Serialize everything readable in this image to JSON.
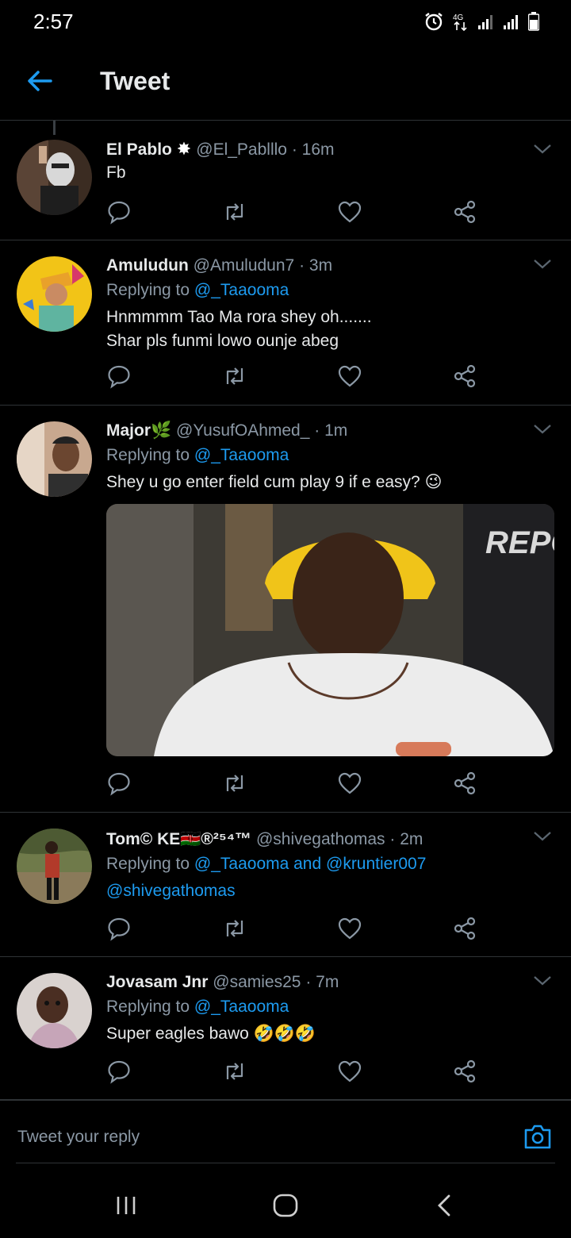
{
  "status_bar": {
    "time": "2:57",
    "network": "4G"
  },
  "header": {
    "title": "Tweet"
  },
  "tweets": [
    {
      "name": "El Pablo",
      "handle": "@El_Pablllo",
      "time": "· 16m",
      "replying_to": "",
      "text_lines": [
        "Fb"
      ]
    },
    {
      "name": "Amuludun",
      "handle": "@Amuludun7",
      "time": "· 3m",
      "replying_prefix": "Replying to",
      "replying_to": "@_Taaooma",
      "text_lines": [
        "Hnmmmm Tao Ma rora shey oh.......",
        "Shar pls funmi lowo ounje abeg"
      ]
    },
    {
      "name": "Major🌿",
      "handle": "@YusufOAhmed_",
      "time": "· 1m",
      "replying_prefix": "Replying to",
      "replying_to": "@_Taaooma",
      "text_lines": [
        "Shey u go enter field cum play 9 if e easy? 😉"
      ],
      "media_text": "REPO"
    },
    {
      "name": "Tom© KE🇰🇪®²⁵⁴™",
      "handle": "@shivegathomas",
      "time": "· 2m",
      "replying_prefix": "Replying to",
      "replying_to": "@_Taaooma and @kruntier007",
      "text_lines": [
        "@shivegathomas"
      ]
    },
    {
      "name": "Jovasam Jnr",
      "handle": "@samies25",
      "time": "· 7m",
      "replying_prefix": "Replying to",
      "replying_to": "@_Taaooma",
      "text_lines": [
        "Super eagles bawo 🤣🤣🤣"
      ]
    }
  ],
  "reply_bar": {
    "placeholder": "Tweet your reply"
  },
  "icons": {
    "back": "arrow-left-icon",
    "reply": "comment-icon",
    "retweet": "retweet-icon",
    "like": "heart-icon",
    "share": "share-icon",
    "camera": "camera-icon"
  },
  "colors": {
    "accent": "#1d9bf0",
    "background": "#000000",
    "secondary_text": "#8b98a5"
  }
}
